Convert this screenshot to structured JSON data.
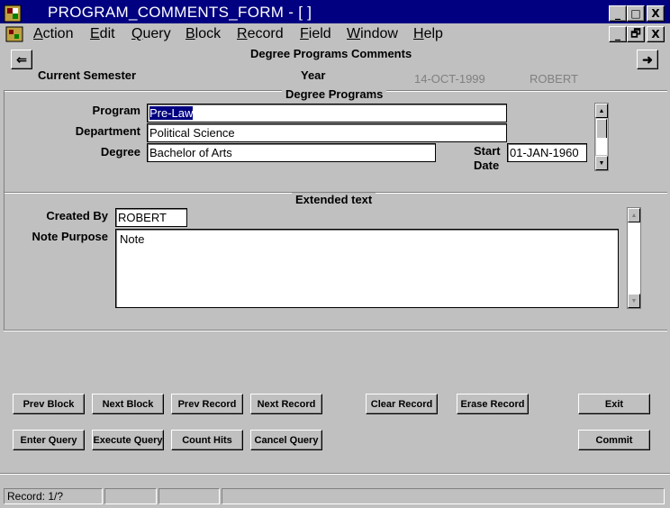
{
  "window": {
    "title": "PROGRAM_COMMENTS_FORM - [ ]",
    "minimize_label": "_",
    "maximize_label": "□",
    "close_label": "X",
    "doc_minimize_label": "_",
    "doc_restore_label": "🗗",
    "doc_close_label": "X"
  },
  "menu": {
    "items": [
      {
        "u": "A",
        "rest": "ction"
      },
      {
        "u": "E",
        "rest": "dit"
      },
      {
        "u": "Q",
        "rest": "uery"
      },
      {
        "u": "B",
        "rest": "lock"
      },
      {
        "u": "R",
        "rest": "ecord"
      },
      {
        "u": "F",
        "rest": "ield"
      },
      {
        "u": "W",
        "rest": "indow"
      },
      {
        "u": "H",
        "rest": "elp"
      }
    ]
  },
  "header": {
    "back_icon": "⇐",
    "forward_icon": "➜",
    "form_title": "Degree Programs Comments",
    "current_semester_label": "Current Semester",
    "year_label": "Year",
    "date": "14-OCT-1999",
    "user": "ROBERT"
  },
  "degree_programs": {
    "title": "Degree Programs",
    "program_label": "Program",
    "program_value": "Pre-Law",
    "department_label": "Department",
    "department_value": "Political Science",
    "degree_label": "Degree",
    "degree_value": "Bachelor of Arts",
    "start_label_1": "Start",
    "start_label_2": "Date",
    "start_date_value": "01-JAN-1960"
  },
  "extended_text": {
    "title": "Extended text",
    "created_by_label": "Created By",
    "created_by_value": "ROBERT",
    "note_purpose_label": "Note Purpose",
    "note_value": "Note"
  },
  "buttons": {
    "prev_block": "Prev Block",
    "next_block": "Next Block",
    "prev_record": "Prev Record",
    "next_record": "Next Record",
    "clear_record": "Clear Record",
    "erase_record": "Erase Record",
    "exit": "Exit",
    "enter_query": "Enter Query",
    "execute_query": "Execute Query",
    "count_hits": "Count Hits",
    "cancel_query": "Cancel Query",
    "commit": "Commit"
  },
  "status": {
    "record": "Record: 1/?"
  },
  "icons": {
    "app": "oracle-forms-app-icon",
    "doc": "document-icon",
    "scroll_up": "▲",
    "scroll_down": "▼"
  }
}
